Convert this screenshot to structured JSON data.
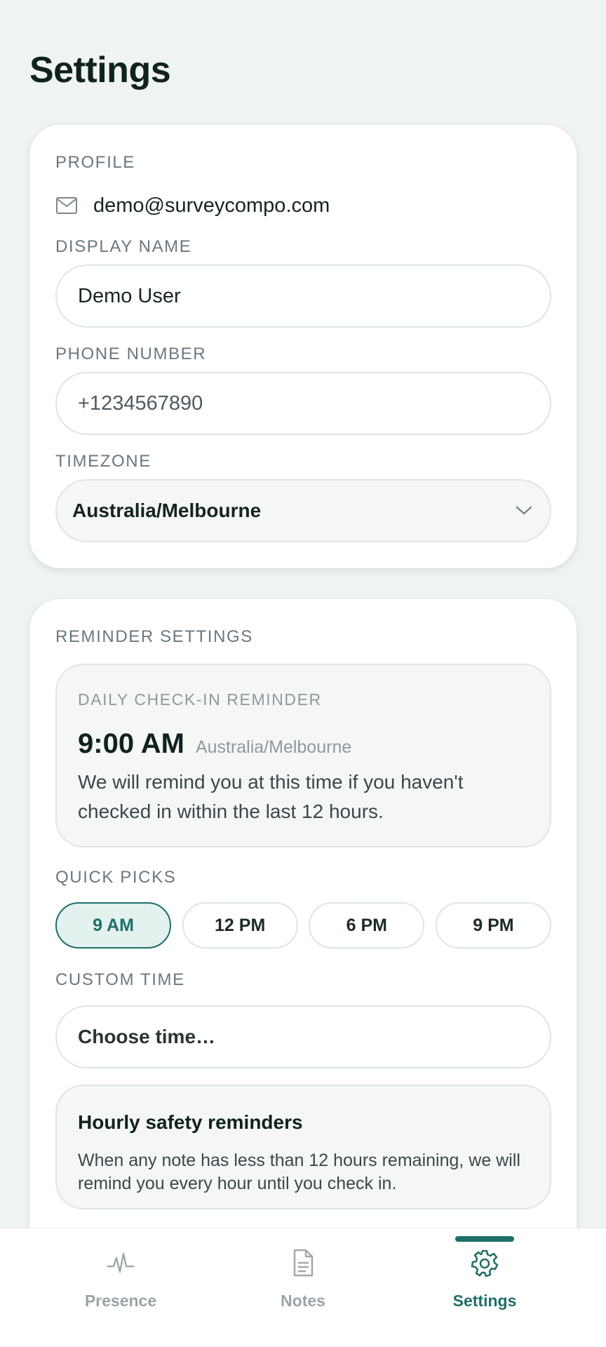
{
  "page": {
    "title": "Settings"
  },
  "profile": {
    "section_label": "PROFILE",
    "email": "demo@surveycompo.com",
    "display_name_label": "DISPLAY NAME",
    "display_name_value": "Demo User",
    "phone_label": "PHONE NUMBER",
    "phone_value": "+1234567890",
    "timezone_label": "TIMEZONE",
    "timezone_value": "Australia/Melbourne"
  },
  "reminders": {
    "section_label": "REMINDER SETTINGS",
    "daily": {
      "label": "DAILY CHECK-IN REMINDER",
      "time": "9:00 AM",
      "timezone": "Australia/Melbourne",
      "description": "We will remind you at this time if you haven't checked in within the last 12 hours."
    },
    "quick_picks_label": "QUICK PICKS",
    "quick_picks": [
      {
        "label": "9 AM",
        "selected": true
      },
      {
        "label": "12 PM",
        "selected": false
      },
      {
        "label": "6 PM",
        "selected": false
      },
      {
        "label": "9 PM",
        "selected": false
      }
    ],
    "custom_time_label": "CUSTOM TIME",
    "custom_time_placeholder": "Choose time…",
    "hourly": {
      "title": "Hourly safety reminders",
      "description": "When any note has less than 12 hours remaining, we will remind you every hour until you check in."
    }
  },
  "nav": {
    "items": [
      {
        "label": "Presence",
        "icon": "pulse-icon",
        "active": false
      },
      {
        "label": "Notes",
        "icon": "document-icon",
        "active": false
      },
      {
        "label": "Settings",
        "icon": "gear-icon",
        "active": true
      }
    ]
  },
  "colors": {
    "accent": "#1f6f68",
    "background": "#eff3f2",
    "card": "#ffffff",
    "muted_label": "#6b7780"
  }
}
